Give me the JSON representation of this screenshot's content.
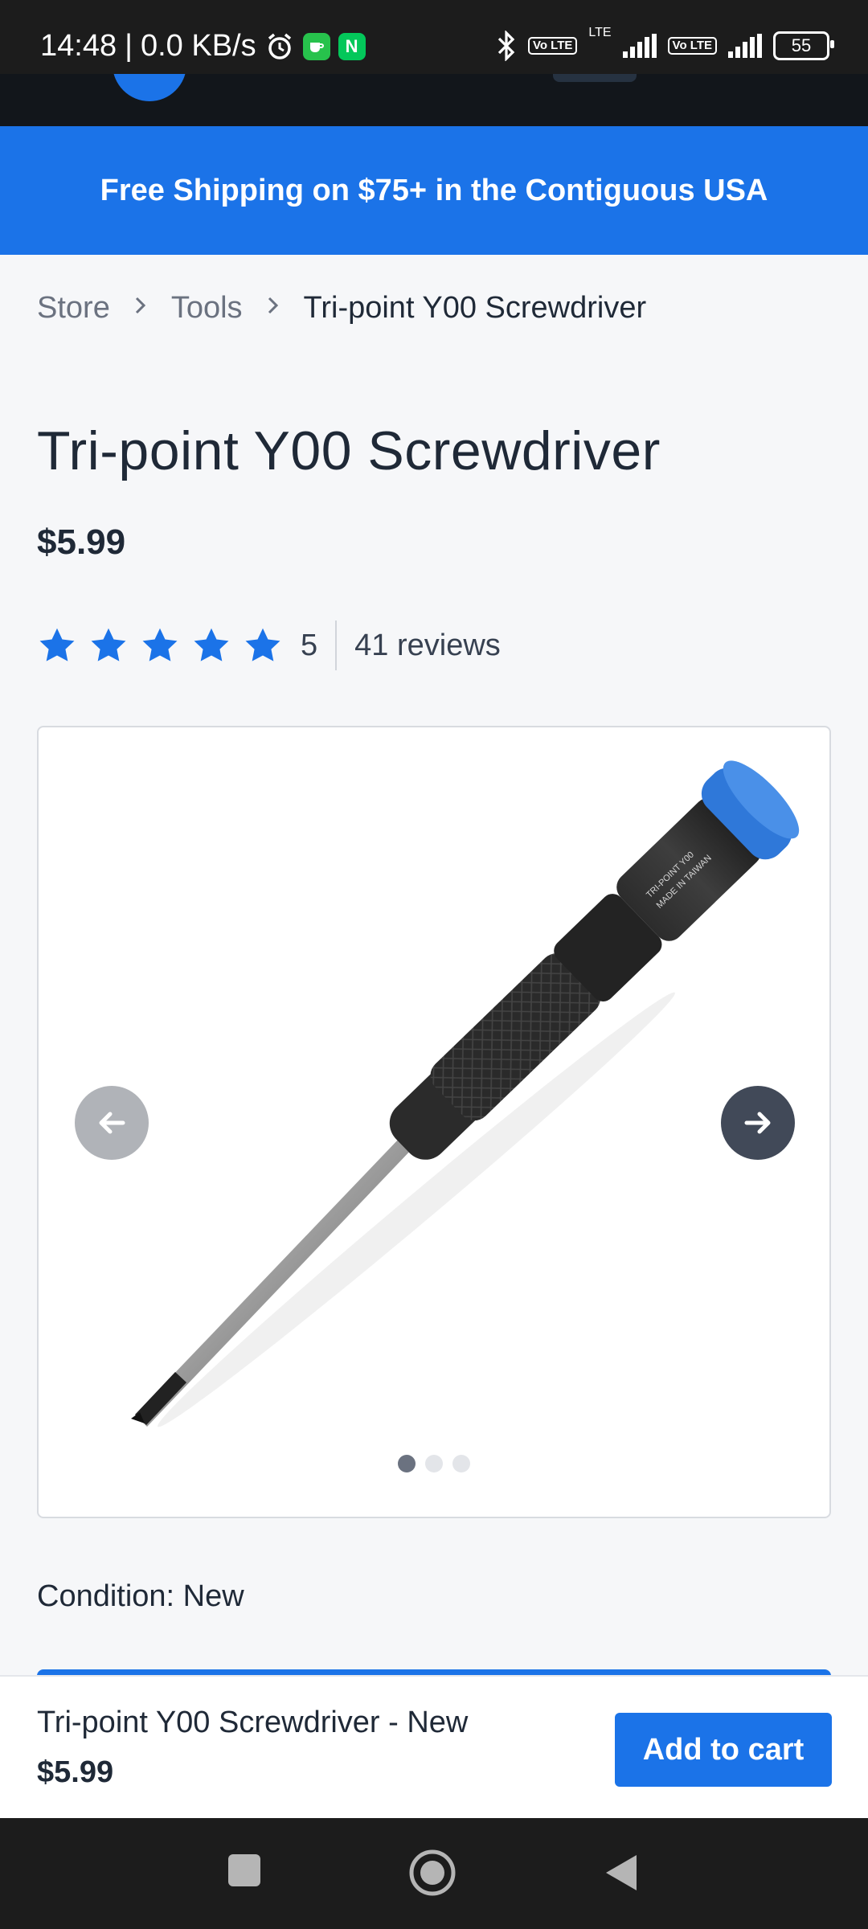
{
  "status_bar": {
    "time": "14:48",
    "speed": "0.0 KB/s",
    "volte_label": "Vo LTE",
    "lte_label": "LTE",
    "battery": "55"
  },
  "promo": {
    "text": "Free Shipping on $75+ in the Contiguous USA"
  },
  "breadcrumb": {
    "items": [
      "Store",
      "Tools"
    ],
    "current": "Tri-point Y00 Screwdriver"
  },
  "product": {
    "title": "Tri-point Y00 Screwdriver",
    "price": "$5.99",
    "rating_value": "5",
    "rating_stars": 5,
    "reviews": "41 reviews",
    "handle_print": [
      "TRI-POINT Y00",
      "MADE IN TAIWAN"
    ],
    "gallery_slides": 3,
    "gallery_active_index": 0,
    "condition": "Condition: New"
  },
  "sticky_bar": {
    "name": "Tri-point Y00 Screwdriver - New",
    "price": "$5.99",
    "add_to_cart": "Add to cart"
  },
  "colors": {
    "accent": "#1b73e8",
    "star": "#1b73e8",
    "text": "#1f2937",
    "muted": "#6b7280",
    "page_bg": "#f6f7f9",
    "header_bg": "#12161b"
  },
  "icons": [
    "alarm-icon",
    "bluetooth-icon",
    "signal-icon",
    "battery-icon",
    "chevron-right-icon",
    "star-icon",
    "arrow-left-icon",
    "arrow-right-icon",
    "recents-icon",
    "home-icon",
    "back-icon"
  ]
}
